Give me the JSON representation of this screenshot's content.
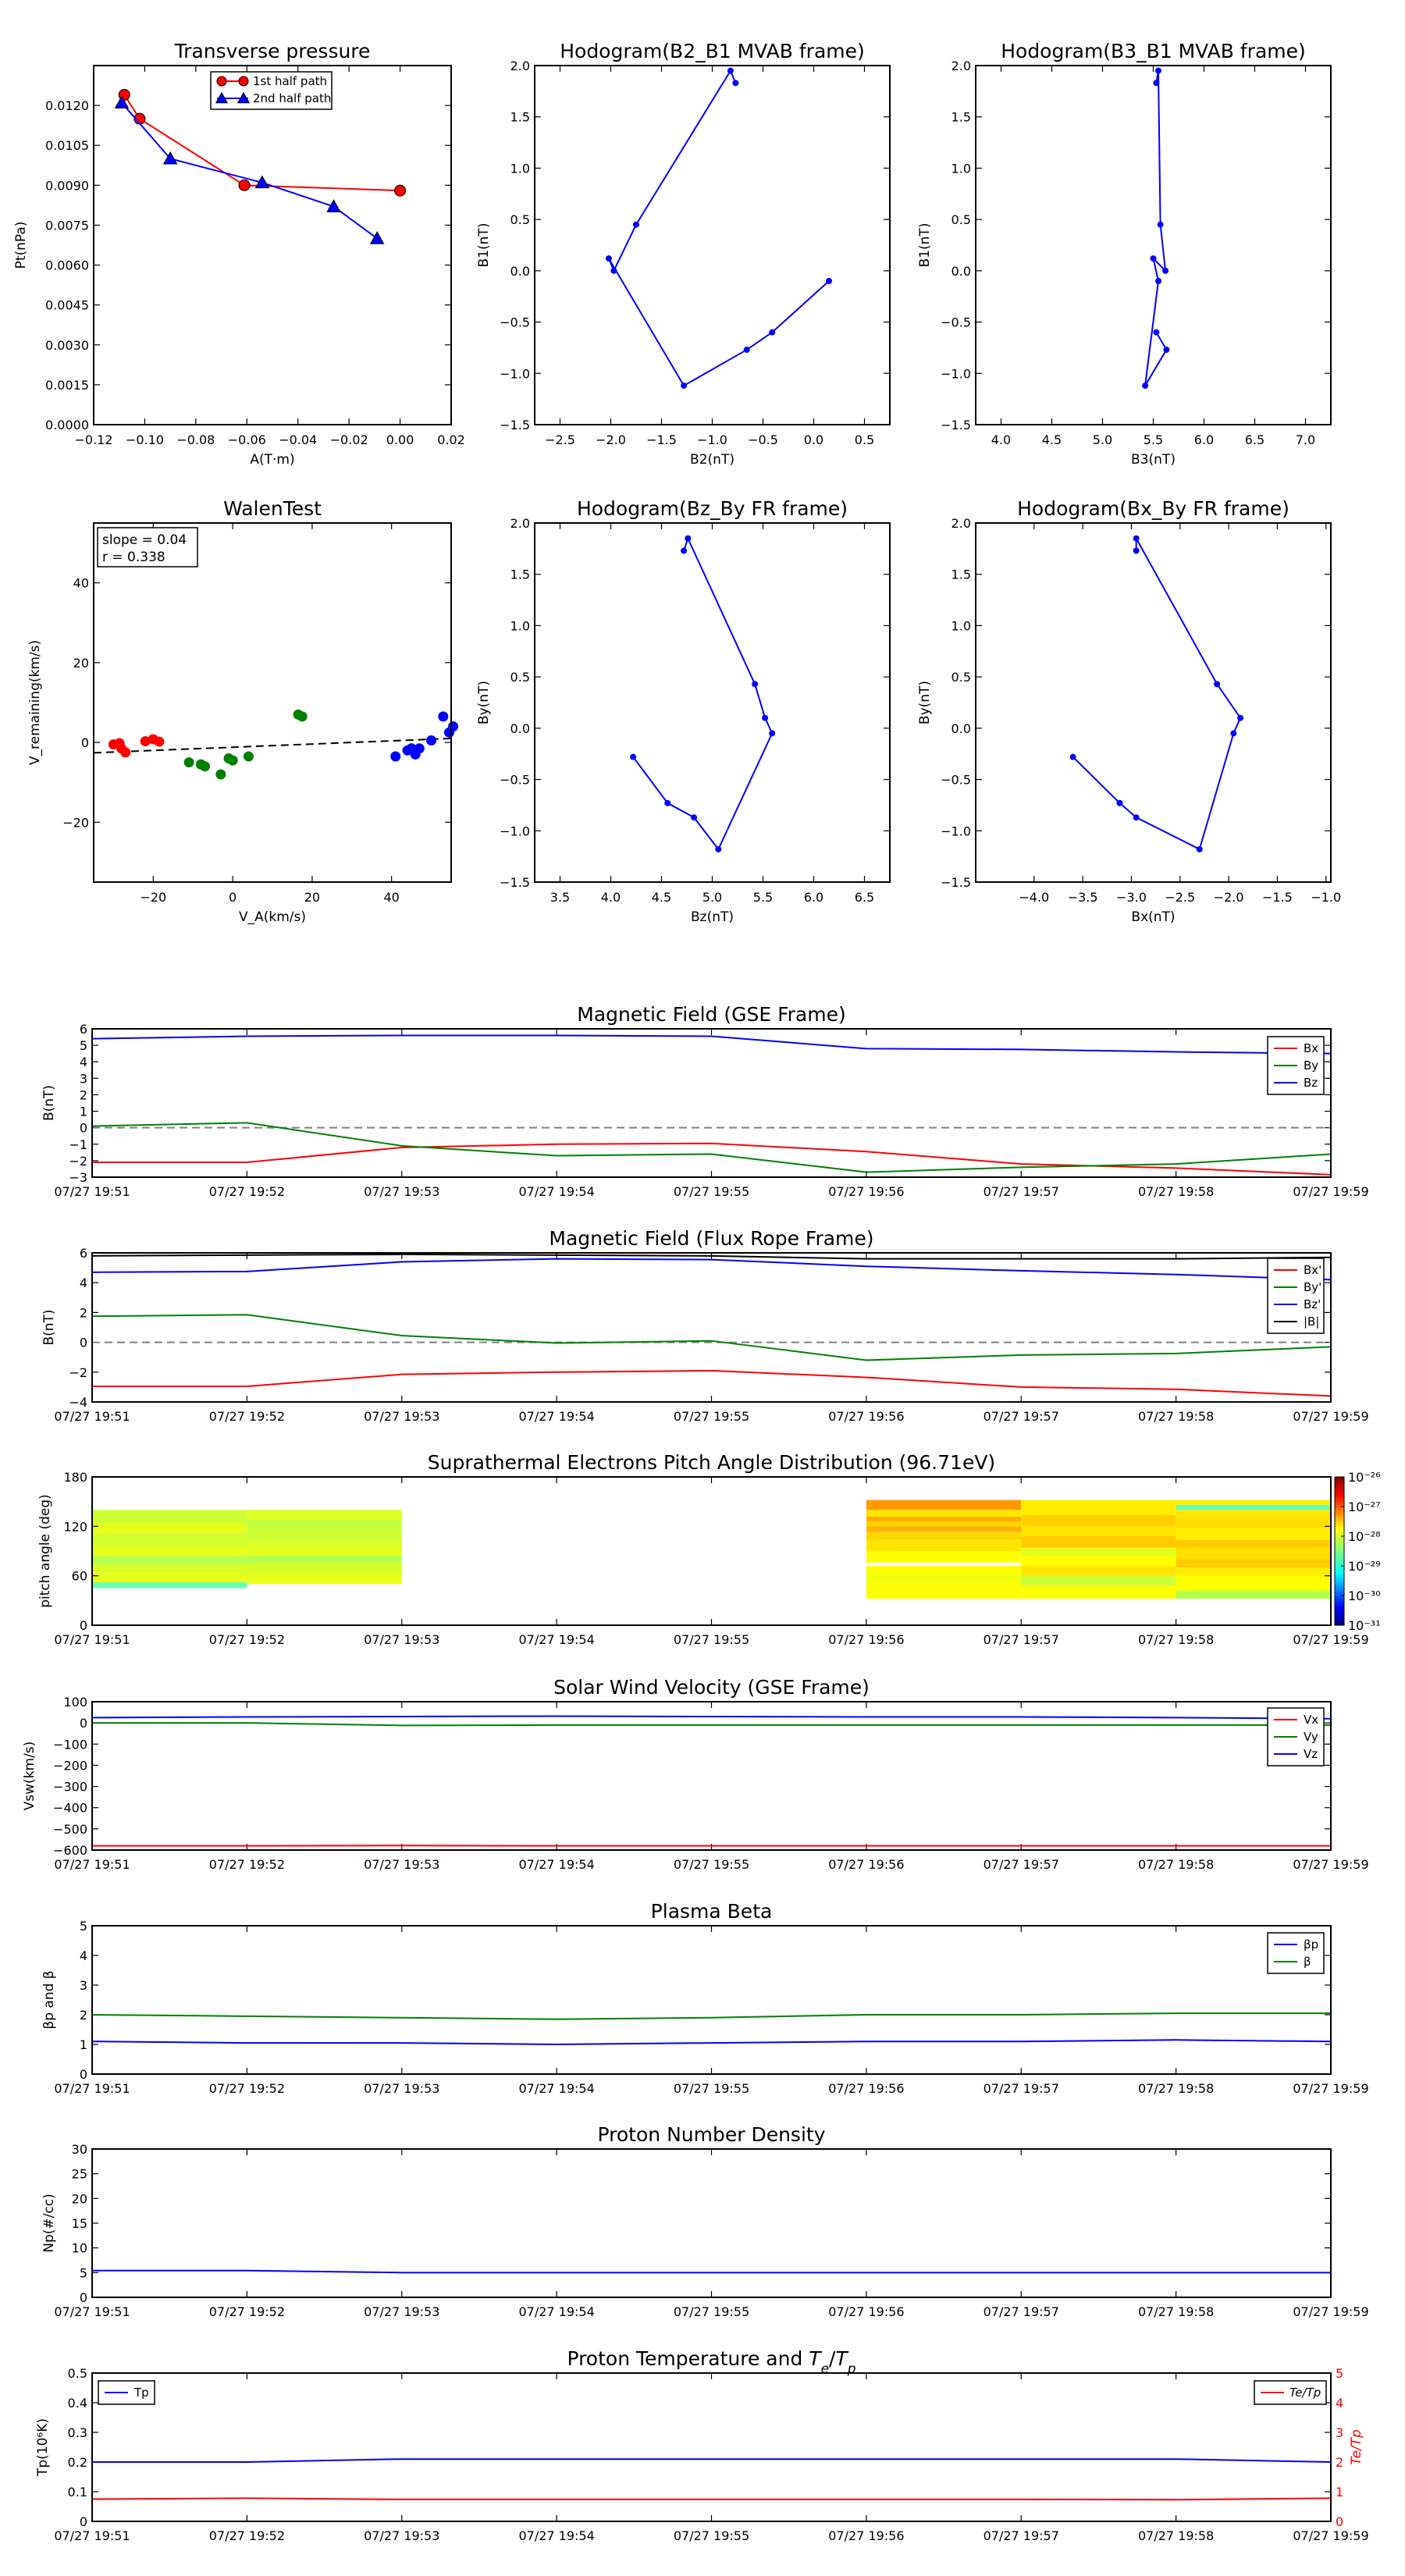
{
  "time_ticks": [
    "07/27 19:51",
    "07/27 19:52",
    "07/27 19:53",
    "07/27 19:54",
    "07/27 19:55",
    "07/27 19:56",
    "07/27 19:57",
    "07/27 19:58",
    "07/27 19:59"
  ],
  "chart_data": [
    {
      "id": "transverse_pressure",
      "type": "line",
      "title": "Transverse pressure",
      "xlabel": "A(T·m)",
      "ylabel": "Pt(nPa)",
      "xlim": [
        -0.12,
        0.02
      ],
      "ylim": [
        0,
        0.0135
      ],
      "xticks": [
        "−0.12",
        "−0.10",
        "−0.08",
        "−0.06",
        "−0.04",
        "−0.02",
        "0.00",
        "0.02"
      ],
      "yticks": [
        "0.0000",
        "0.0015",
        "0.0030",
        "0.0045",
        "0.0060",
        "0.0075",
        "0.0090",
        "0.0105",
        "0.0120"
      ],
      "legend": "top-center",
      "series": [
        {
          "name": "1st half path",
          "color": "#ff0000",
          "marker": "circle",
          "x": [
            -0.108,
            -0.102,
            -0.061,
            0.0
          ],
          "y": [
            0.0124,
            0.0115,
            0.009,
            0.0088
          ]
        },
        {
          "name": "2nd half path",
          "color": "#0000ff",
          "marker": "triangle",
          "x": [
            -0.109,
            -0.09,
            -0.054,
            -0.026,
            -0.009
          ],
          "y": [
            0.0121,
            0.01,
            0.0091,
            0.0082,
            0.007
          ]
        }
      ]
    },
    {
      "id": "hodogram_b2_b1",
      "type": "line",
      "title": "Hodogram(B2_B1 MVAB frame)",
      "xlabel": "B2(nT)",
      "ylabel": "B1(nT)",
      "xlim": [
        -2.75,
        0.75
      ],
      "ylim": [
        -1.5,
        2.0
      ],
      "xticks": [
        "−2.5",
        "−2.0",
        "−1.5",
        "−1.0",
        "−0.5",
        "0.0",
        "0.5"
      ],
      "yticks": [
        "−1.5",
        "−1.0",
        "−0.5",
        "0.0",
        "0.5",
        "1.0",
        "1.5",
        "2.0"
      ],
      "series": [
        {
          "color": "#0000ff",
          "x": [
            -0.77,
            -0.82,
            -1.75,
            -1.97,
            -2.02,
            -1.28,
            -0.66,
            -0.41,
            0.15
          ],
          "y": [
            1.83,
            1.95,
            0.45,
            0.0,
            0.12,
            -1.12,
            -0.77,
            -0.6,
            -0.1
          ]
        }
      ]
    },
    {
      "id": "hodogram_b3_b1",
      "type": "line",
      "title": "Hodogram(B3_B1 MVAB frame)",
      "xlabel": "B3(nT)",
      "ylabel": "B1(nT)",
      "xlim": [
        3.75,
        7.25
      ],
      "ylim": [
        -1.5,
        2.0
      ],
      "xticks": [
        "4.0",
        "4.5",
        "5.0",
        "5.5",
        "6.0",
        "6.5",
        "7.0"
      ],
      "yticks": [
        "−1.5",
        "−1.0",
        "−0.5",
        "0.0",
        "0.5",
        "1.0",
        "1.5",
        "2.0"
      ],
      "series": [
        {
          "color": "#0000ff",
          "x": [
            5.53,
            5.55,
            5.57,
            5.62,
            5.5,
            5.55,
            5.42,
            5.63,
            5.53
          ],
          "y": [
            1.83,
            1.95,
            0.45,
            0.0,
            0.12,
            -0.1,
            -1.12,
            -0.77,
            -0.6
          ]
        }
      ]
    },
    {
      "id": "walen_test",
      "type": "scatter",
      "title": "WalenTest",
      "xlabel": "V_A(km/s)",
      "ylabel": "V_remaining(km/s)",
      "xlim": [
        -35,
        55
      ],
      "ylim": [
        -35,
        55
      ],
      "xticks": [
        "−20",
        "0",
        "20",
        "40"
      ],
      "yticks": [
        "−20",
        "0",
        "20",
        "40"
      ],
      "annotation": [
        "slope = 0.04",
        "r = 0.338"
      ],
      "fit": {
        "slope": 0.04,
        "intercept": -1.2
      },
      "series": [
        {
          "color": "#ff0000",
          "x": [
            -30,
            -28.5,
            -28,
            -27,
            -22,
            -20,
            -18.5
          ],
          "y": [
            -0.5,
            -0.2,
            -1.5,
            -2.5,
            0.3,
            0.8,
            0.2
          ]
        },
        {
          "color": "#008000",
          "x": [
            -11,
            -8,
            -7,
            -3,
            -1,
            0,
            4,
            16.5,
            17.5
          ],
          "y": [
            -5,
            -5.5,
            -6,
            -8,
            -4,
            -4.5,
            -3.5,
            7,
            6.5
          ]
        },
        {
          "color": "#0000ff",
          "x": [
            41,
            44,
            45,
            46,
            47,
            50,
            53,
            54.5,
            55.5
          ],
          "y": [
            -3.5,
            -2,
            -1.5,
            -3,
            -1.5,
            0.5,
            6.5,
            2.5,
            4
          ]
        }
      ]
    },
    {
      "id": "hodogram_bz_by",
      "type": "line",
      "title": "Hodogram(Bz_By FR frame)",
      "xlabel": "Bz(nT)",
      "ylabel": "By(nT)",
      "xlim": [
        3.25,
        6.75
      ],
      "ylim": [
        -1.5,
        2.0
      ],
      "xticks": [
        "3.5",
        "4.0",
        "4.5",
        "5.0",
        "5.5",
        "6.0",
        "6.5"
      ],
      "yticks": [
        "−1.5",
        "−1.0",
        "−0.5",
        "0.0",
        "0.5",
        "1.0",
        "1.5",
        "2.0"
      ],
      "series": [
        {
          "color": "#0000ff",
          "x": [
            4.72,
            4.76,
            5.42,
            5.52,
            5.59,
            5.06,
            4.82,
            4.56,
            4.22
          ],
          "y": [
            1.73,
            1.85,
            0.43,
            0.1,
            -0.05,
            -1.18,
            -0.87,
            -0.73,
            -0.28
          ]
        }
      ]
    },
    {
      "id": "hodogram_bx_by",
      "type": "line",
      "title": "Hodogram(Bx_By FR frame)",
      "xlabel": "Bx(nT)",
      "ylabel": "By(nT)",
      "xlim": [
        -4.6,
        -0.95
      ],
      "ylim": [
        -1.5,
        2.0
      ],
      "xticks": [
        "−4.0",
        "−3.5",
        "−3.0",
        "−2.5",
        "−2.0",
        "−1.5",
        "−1.0"
      ],
      "yticks": [
        "−1.5",
        "−1.0",
        "−0.5",
        "0.0",
        "0.5",
        "1.0",
        "1.5",
        "2.0"
      ],
      "series": [
        {
          "color": "#0000ff",
          "x": [
            -2.95,
            -2.95,
            -2.12,
            -1.88,
            -1.95,
            -2.3,
            -2.95,
            -3.12,
            -3.6
          ],
          "y": [
            1.73,
            1.85,
            0.43,
            0.1,
            -0.05,
            -1.18,
            -0.87,
            -0.73,
            -0.28
          ]
        }
      ]
    },
    {
      "id": "mag_gse",
      "type": "line",
      "title": "Magnetic Field (GSE Frame)",
      "xlabel": "",
      "ylabel": "B(nT)",
      "ylim": [
        -3,
        6
      ],
      "yticks": [
        "−3",
        "−2",
        "−1",
        "0",
        "1",
        "2",
        "3",
        "4",
        "5",
        "6"
      ],
      "zero_line": true,
      "legend": "top-right",
      "x": [
        0,
        1,
        2,
        3,
        4,
        5,
        6,
        7,
        8
      ],
      "series": [
        {
          "name": "Bx",
          "color": "#ff0000",
          "values": [
            -2.1,
            -2.1,
            -1.2,
            -1.0,
            -0.95,
            -1.45,
            -2.2,
            -2.45,
            -2.85
          ]
        },
        {
          "name": "By",
          "color": "#008000",
          "values": [
            0.1,
            0.3,
            -1.1,
            -1.7,
            -1.6,
            -2.7,
            -2.4,
            -2.2,
            -1.6
          ]
        },
        {
          "name": "Bz",
          "color": "#0000ff",
          "values": [
            5.4,
            5.55,
            5.6,
            5.6,
            5.55,
            4.8,
            4.75,
            4.6,
            4.5
          ]
        }
      ]
    },
    {
      "id": "mag_fr",
      "type": "line",
      "title": "Magnetic Field (Flux Rope Frame)",
      "xlabel": "",
      "ylabel": "B(nT)",
      "ylim": [
        -4,
        6
      ],
      "yticks": [
        "−4",
        "−2",
        "0",
        "2",
        "4",
        "6"
      ],
      "zero_line": true,
      "legend": "top-right",
      "x": [
        0,
        1,
        2,
        3,
        4,
        5,
        6,
        7,
        8
      ],
      "series": [
        {
          "name": "Bx'",
          "color": "#ff0000",
          "values": [
            -2.95,
            -2.95,
            -2.15,
            -2.0,
            -1.9,
            -2.35,
            -3.0,
            -3.15,
            -3.6
          ]
        },
        {
          "name": "By'",
          "color": "#008000",
          "values": [
            1.75,
            1.85,
            0.45,
            -0.05,
            0.1,
            -1.2,
            -0.85,
            -0.75,
            -0.3
          ]
        },
        {
          "name": "Bz'",
          "color": "#0000ff",
          "values": [
            4.7,
            4.75,
            5.4,
            5.6,
            5.55,
            5.1,
            4.8,
            4.55,
            4.2
          ]
        },
        {
          "name": "|B|",
          "color": "#000000",
          "values": [
            5.8,
            5.85,
            5.9,
            5.85,
            5.8,
            5.6,
            5.6,
            5.6,
            5.7
          ]
        }
      ]
    },
    {
      "id": "pitch_angle",
      "type": "heatmap",
      "title": "Suprathermal Electrons Pitch Angle Distribution (96.71eV)",
      "xlabel": "",
      "ylabel": "pitch angle (deg)",
      "ylim": [
        0,
        180
      ],
      "yticks": [
        "0",
        "60",
        "120",
        "180"
      ],
      "colorbar_ticks": [
        "10⁻²⁶",
        "10⁻²⁷",
        "10⁻²⁸",
        "10⁻²⁹",
        "10⁻³⁰",
        "10⁻³¹"
      ],
      "blocks": [
        {
          "x0": 0,
          "x1": 1,
          "bins": [
            [
              45,
              52,
              "#66ffb3"
            ],
            [
              52,
              64,
              "#e6ff1a"
            ],
            [
              64,
              74,
              "#d8ff26"
            ],
            [
              74,
              84,
              "#b3ff4d"
            ],
            [
              84,
              96,
              "#e6ff1a"
            ],
            [
              96,
              112,
              "#d2ff2d"
            ],
            [
              112,
              124,
              "#e6ff1a"
            ],
            [
              124,
              140,
              "#ccff33"
            ]
          ]
        },
        {
          "x0": 1,
          "x1": 2,
          "bins": [
            [
              50,
              64,
              "#e6ff1a"
            ],
            [
              64,
              76,
              "#d5ff2a"
            ],
            [
              76,
              84,
              "#b3ff4d"
            ],
            [
              84,
              100,
              "#e0ff1f"
            ],
            [
              100,
              118,
              "#ccff33"
            ],
            [
              118,
              128,
              "#bfff40"
            ],
            [
              128,
              140,
              "#ddff22"
            ]
          ]
        },
        {
          "x0": 5,
          "x1": 6,
          "bins": [
            [
              32,
              52,
              "#ffff00"
            ],
            [
              52,
              62,
              "#f2ff0d"
            ],
            [
              62,
              72,
              "#ffff00"
            ],
            [
              72,
              76,
              "#ffffff"
            ],
            [
              76,
              90,
              "#ffff00"
            ],
            [
              90,
              104,
              "#ffe600"
            ],
            [
              104,
              114,
              "#ffd400"
            ],
            [
              114,
              120,
              "#ffb000"
            ],
            [
              120,
              126,
              "#ffd400"
            ],
            [
              126,
              132,
              "#ffb000"
            ],
            [
              132,
              140,
              "#ffe600"
            ],
            [
              140,
              152,
              "#ff9900"
            ]
          ]
        },
        {
          "x0": 6,
          "x1": 7,
          "bins": [
            [
              32,
              48,
              "#ffff00"
            ],
            [
              48,
              60,
              "#ccff33"
            ],
            [
              60,
              72,
              "#ffe600"
            ],
            [
              72,
              84,
              "#ffff00"
            ],
            [
              84,
              94,
              "#e6ff1a"
            ],
            [
              94,
              108,
              "#ffcc00"
            ],
            [
              108,
              120,
              "#ffe600"
            ],
            [
              120,
              134,
              "#ffd000"
            ],
            [
              134,
              152,
              "#ffee00"
            ]
          ]
        },
        {
          "x0": 7,
          "x1": 8,
          "bins": [
            [
              32,
              42,
              "#b3ff4d"
            ],
            [
              42,
              60,
              "#ffff00"
            ],
            [
              60,
              70,
              "#ffee00"
            ],
            [
              70,
              80,
              "#ffcc00"
            ],
            [
              80,
              94,
              "#ffe000"
            ],
            [
              94,
              104,
              "#ffcc00"
            ],
            [
              104,
              118,
              "#ffee00"
            ],
            [
              118,
              128,
              "#ffdd00"
            ],
            [
              128,
              140,
              "#ffe600"
            ],
            [
              140,
              146,
              "#66ffb3"
            ],
            [
              146,
              152,
              "#ffee00"
            ]
          ]
        }
      ]
    },
    {
      "id": "solar_wind_velocity",
      "type": "line",
      "title": "Solar Wind Velocity (GSE Frame)",
      "xlabel": "",
      "ylabel": "Vsw(km/s)",
      "ylim": [
        -600,
        100
      ],
      "yticks": [
        "−600",
        "−500",
        "−400",
        "−300",
        "−200",
        "−100",
        "0",
        "100"
      ],
      "legend": "top-right",
      "x": [
        0,
        1,
        2,
        3,
        4,
        5,
        6,
        7,
        8
      ],
      "series": [
        {
          "name": "Vx",
          "color": "#ff0000",
          "values": [
            -580,
            -580,
            -579,
            -580,
            -580,
            -580,
            -580,
            -580,
            -580
          ]
        },
        {
          "name": "Vy",
          "color": "#008000",
          "values": [
            0,
            0,
            -12,
            -10,
            -10,
            -10,
            -10,
            -10,
            -10
          ]
        },
        {
          "name": "Vz",
          "color": "#0000ff",
          "values": [
            25,
            28,
            30,
            32,
            30,
            28,
            28,
            25,
            20
          ]
        }
      ]
    },
    {
      "id": "plasma_beta",
      "type": "line",
      "title": "Plasma Beta",
      "xlabel": "",
      "ylabel": "βp and β",
      "ylim": [
        0,
        5
      ],
      "yticks": [
        "0",
        "1",
        "2",
        "3",
        "4",
        "5"
      ],
      "legend": "top-right",
      "x": [
        0,
        1,
        2,
        3,
        4,
        5,
        6,
        7,
        8
      ],
      "series": [
        {
          "name": "βp",
          "color": "#0000ff",
          "values": [
            1.1,
            1.05,
            1.05,
            1.0,
            1.05,
            1.1,
            1.1,
            1.15,
            1.1
          ]
        },
        {
          "name": "β",
          "color": "#008000",
          "values": [
            2.0,
            1.95,
            1.9,
            1.85,
            1.9,
            2.0,
            2.0,
            2.05,
            2.05
          ]
        }
      ]
    },
    {
      "id": "proton_density",
      "type": "line",
      "title": "Proton Number Density",
      "xlabel": "",
      "ylabel": "Np(#/cc)",
      "ylim": [
        0,
        30
      ],
      "yticks": [
        "0",
        "5",
        "10",
        "15",
        "20",
        "25",
        "30"
      ],
      "x": [
        0,
        1,
        2,
        3,
        4,
        5,
        6,
        7,
        8
      ],
      "series": [
        {
          "color": "#0000ff",
          "values": [
            5.4,
            5.4,
            5.0,
            5.0,
            5.0,
            5.0,
            5.0,
            5.0,
            5.0
          ]
        }
      ]
    },
    {
      "id": "proton_temperature",
      "type": "line",
      "title": "Proton Temperature and Te/Tp",
      "title_parts": [
        "Proton Temperature and ",
        "T",
        "e",
        "/",
        "T",
        "p"
      ],
      "xlabel": "",
      "ylabel": "Tp(10⁶K)",
      "ylabel_right": "Te/Tp",
      "ylim": [
        0,
        0.5
      ],
      "ylim_right": [
        0,
        5
      ],
      "yticks": [
        "0",
        "0.1",
        "0.2",
        "0.3",
        "0.4",
        "0.5"
      ],
      "yticks_right": [
        "0",
        "1",
        "2",
        "3",
        "4",
        "5"
      ],
      "x": [
        0,
        1,
        2,
        3,
        4,
        5,
        6,
        7,
        8
      ],
      "series": [
        {
          "name": "Tp",
          "color": "#0000ff",
          "axis": "left",
          "values": [
            0.2,
            0.2,
            0.21,
            0.21,
            0.21,
            0.21,
            0.21,
            0.21,
            0.2
          ]
        },
        {
          "name": "Te/Tp",
          "color": "#ff0000",
          "axis": "right",
          "values": [
            0.75,
            0.78,
            0.74,
            0.74,
            0.74,
            0.74,
            0.74,
            0.73,
            0.78
          ]
        }
      ]
    }
  ]
}
